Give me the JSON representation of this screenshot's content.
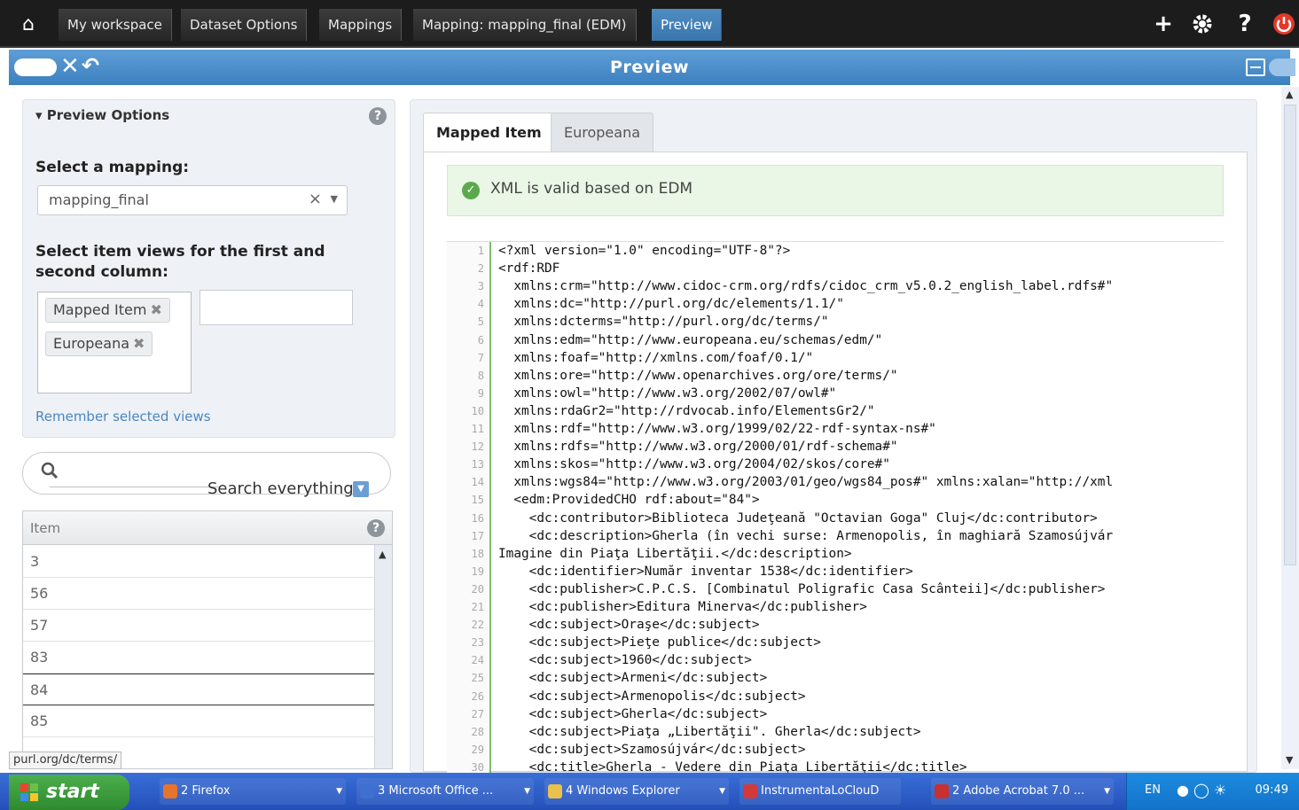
{
  "breadcrumb": [
    {
      "label": "My workspace"
    },
    {
      "label": "Dataset Options"
    },
    {
      "label": "Mappings"
    },
    {
      "label": "Mapping: mapping_final (EDM)"
    },
    {
      "label": "Preview"
    }
  ],
  "top_icons": {
    "add": "+",
    "settings": "gear-icon",
    "help": "?",
    "power": "power-icon"
  },
  "titlebar": {
    "title": "Preview"
  },
  "options": {
    "title": "▾ Preview Options",
    "help": "?",
    "select_mapping_label": "Select a mapping:",
    "mapping_value": "mapping_final",
    "views_label": "Select item views for the first and second column:",
    "views": [
      "Mapped Item",
      "Europeana"
    ],
    "remember_link": "Remember selected views"
  },
  "search": {
    "mode": "Search everything"
  },
  "items": {
    "header": "Item",
    "rows": [
      "3",
      "56",
      "57",
      "83",
      "84",
      "85"
    ]
  },
  "status_url": "purl.org/dc/terms/",
  "preview": {
    "tabs": [
      "Mapped Item",
      "Europeana"
    ],
    "valid_message": "XML is valid based on EDM",
    "line_numbers": [
      "1",
      "2",
      "3",
      "4",
      "5",
      "6",
      "7",
      "8",
      "9",
      "10",
      "11",
      "12",
      "13",
      "14",
      "15",
      "16",
      "17",
      "18",
      "19",
      "20",
      "21",
      "22",
      "23",
      "24",
      "25",
      "26",
      "27",
      "28",
      "29",
      "30"
    ],
    "code_lines": [
      "<?xml version=\"1.0\" encoding=\"UTF-8\"?>",
      "<rdf:RDF",
      "  xmlns:crm=\"http://www.cidoc-crm.org/rdfs/cidoc_crm_v5.0.2_english_label.rdfs#\"",
      "  xmlns:dc=\"http://purl.org/dc/elements/1.1/\"",
      "  xmlns:dcterms=\"http://purl.org/dc/terms/\"",
      "  xmlns:edm=\"http://www.europeana.eu/schemas/edm/\"",
      "  xmlns:foaf=\"http://xmlns.com/foaf/0.1/\"",
      "  xmlns:ore=\"http://www.openarchives.org/ore/terms/\"",
      "  xmlns:owl=\"http://www.w3.org/2002/07/owl#\"",
      "  xmlns:rdaGr2=\"http://rdvocab.info/ElementsGr2/\"",
      "  xmlns:rdf=\"http://www.w3.org/1999/02/22-rdf-syntax-ns#\"",
      "  xmlns:rdfs=\"http://www.w3.org/2000/01/rdf-schema#\"",
      "  xmlns:skos=\"http://www.w3.org/2004/02/skos/core#\"",
      "  xmlns:wgs84=\"http://www.w3.org/2003/01/geo/wgs84_pos#\" xmlns:xalan=\"http://xml",
      "  <edm:ProvidedCHO rdf:about=\"84\">",
      "    <dc:contributor>Biblioteca Judeţeană \"Octavian Goga\" Cluj</dc:contributor>",
      "    <dc:description>Gherla (în vechi surse: Armenopolis, în maghiară Szamosújvár",
      "Imagine din Piaţa Libertăţii.</dc:description>",
      "    <dc:identifier>Număr inventar 1538</dc:identifier>",
      "    <dc:publisher>C.P.C.S. [Combinatul Poligrafic Casa Scânteii]</dc:publisher>",
      "    <dc:publisher>Editura Minerva</dc:publisher>",
      "    <dc:subject>Oraşe</dc:subject>",
      "    <dc:subject>Pieţe publice</dc:subject>",
      "    <dc:subject>1960</dc:subject>",
      "    <dc:subject>Armeni</dc:subject>",
      "    <dc:subject>Armenopolis</dc:subject>",
      "    <dc:subject>Gherla</dc:subject>",
      "    <dc:subject>Piaţa „Libertăţii\". Gherla</dc:subject>",
      "    <dc:subject>Szamosújvár</dc:subject>",
      "    <dc:title>Gherla - Vedere din Piaţa Libertăţii</dc:title>"
    ]
  },
  "taskbar": {
    "start": "start",
    "tasks": [
      {
        "label": "2 Firefox",
        "color": "#e8732c"
      },
      {
        "label": "3 Microsoft Office ...",
        "color": "#3f6fd0"
      },
      {
        "label": "4 Windows Explorer",
        "color": "#e8c24a"
      },
      {
        "label": "InstrumentaLoClouD",
        "color": "#d23a3a"
      },
      {
        "label": "2 Adobe Acrobat 7.0 ...",
        "color": "#c93030"
      }
    ],
    "lang": "EN",
    "clock": "09:49"
  }
}
